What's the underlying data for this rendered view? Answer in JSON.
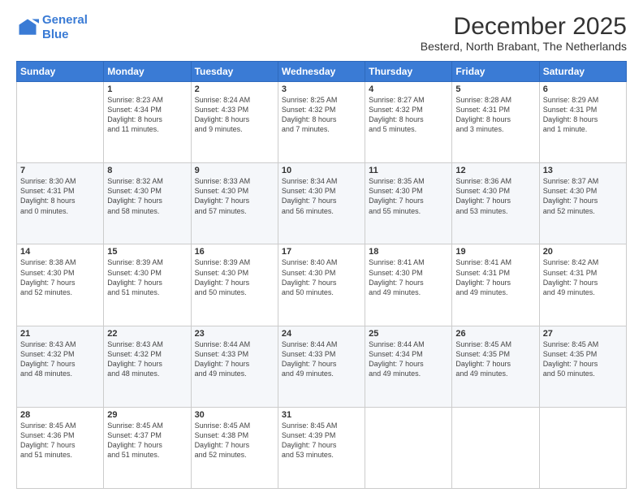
{
  "logo": {
    "line1": "General",
    "line2": "Blue"
  },
  "title": "December 2025",
  "subtitle": "Besterd, North Brabant, The Netherlands",
  "days_of_week": [
    "Sunday",
    "Monday",
    "Tuesday",
    "Wednesday",
    "Thursday",
    "Friday",
    "Saturday"
  ],
  "weeks": [
    [
      {
        "num": "",
        "info": ""
      },
      {
        "num": "1",
        "info": "Sunrise: 8:23 AM\nSunset: 4:34 PM\nDaylight: 8 hours\nand 11 minutes."
      },
      {
        "num": "2",
        "info": "Sunrise: 8:24 AM\nSunset: 4:33 PM\nDaylight: 8 hours\nand 9 minutes."
      },
      {
        "num": "3",
        "info": "Sunrise: 8:25 AM\nSunset: 4:32 PM\nDaylight: 8 hours\nand 7 minutes."
      },
      {
        "num": "4",
        "info": "Sunrise: 8:27 AM\nSunset: 4:32 PM\nDaylight: 8 hours\nand 5 minutes."
      },
      {
        "num": "5",
        "info": "Sunrise: 8:28 AM\nSunset: 4:31 PM\nDaylight: 8 hours\nand 3 minutes."
      },
      {
        "num": "6",
        "info": "Sunrise: 8:29 AM\nSunset: 4:31 PM\nDaylight: 8 hours\nand 1 minute."
      }
    ],
    [
      {
        "num": "7",
        "info": "Sunrise: 8:30 AM\nSunset: 4:31 PM\nDaylight: 8 hours\nand 0 minutes."
      },
      {
        "num": "8",
        "info": "Sunrise: 8:32 AM\nSunset: 4:30 PM\nDaylight: 7 hours\nand 58 minutes."
      },
      {
        "num": "9",
        "info": "Sunrise: 8:33 AM\nSunset: 4:30 PM\nDaylight: 7 hours\nand 57 minutes."
      },
      {
        "num": "10",
        "info": "Sunrise: 8:34 AM\nSunset: 4:30 PM\nDaylight: 7 hours\nand 56 minutes."
      },
      {
        "num": "11",
        "info": "Sunrise: 8:35 AM\nSunset: 4:30 PM\nDaylight: 7 hours\nand 55 minutes."
      },
      {
        "num": "12",
        "info": "Sunrise: 8:36 AM\nSunset: 4:30 PM\nDaylight: 7 hours\nand 53 minutes."
      },
      {
        "num": "13",
        "info": "Sunrise: 8:37 AM\nSunset: 4:30 PM\nDaylight: 7 hours\nand 52 minutes."
      }
    ],
    [
      {
        "num": "14",
        "info": "Sunrise: 8:38 AM\nSunset: 4:30 PM\nDaylight: 7 hours\nand 52 minutes."
      },
      {
        "num": "15",
        "info": "Sunrise: 8:39 AM\nSunset: 4:30 PM\nDaylight: 7 hours\nand 51 minutes."
      },
      {
        "num": "16",
        "info": "Sunrise: 8:39 AM\nSunset: 4:30 PM\nDaylight: 7 hours\nand 50 minutes."
      },
      {
        "num": "17",
        "info": "Sunrise: 8:40 AM\nSunset: 4:30 PM\nDaylight: 7 hours\nand 50 minutes."
      },
      {
        "num": "18",
        "info": "Sunrise: 8:41 AM\nSunset: 4:30 PM\nDaylight: 7 hours\nand 49 minutes."
      },
      {
        "num": "19",
        "info": "Sunrise: 8:41 AM\nSunset: 4:31 PM\nDaylight: 7 hours\nand 49 minutes."
      },
      {
        "num": "20",
        "info": "Sunrise: 8:42 AM\nSunset: 4:31 PM\nDaylight: 7 hours\nand 49 minutes."
      }
    ],
    [
      {
        "num": "21",
        "info": "Sunrise: 8:43 AM\nSunset: 4:32 PM\nDaylight: 7 hours\nand 48 minutes."
      },
      {
        "num": "22",
        "info": "Sunrise: 8:43 AM\nSunset: 4:32 PM\nDaylight: 7 hours\nand 48 minutes."
      },
      {
        "num": "23",
        "info": "Sunrise: 8:44 AM\nSunset: 4:33 PM\nDaylight: 7 hours\nand 49 minutes."
      },
      {
        "num": "24",
        "info": "Sunrise: 8:44 AM\nSunset: 4:33 PM\nDaylight: 7 hours\nand 49 minutes."
      },
      {
        "num": "25",
        "info": "Sunrise: 8:44 AM\nSunset: 4:34 PM\nDaylight: 7 hours\nand 49 minutes."
      },
      {
        "num": "26",
        "info": "Sunrise: 8:45 AM\nSunset: 4:35 PM\nDaylight: 7 hours\nand 49 minutes."
      },
      {
        "num": "27",
        "info": "Sunrise: 8:45 AM\nSunset: 4:35 PM\nDaylight: 7 hours\nand 50 minutes."
      }
    ],
    [
      {
        "num": "28",
        "info": "Sunrise: 8:45 AM\nSunset: 4:36 PM\nDaylight: 7 hours\nand 51 minutes."
      },
      {
        "num": "29",
        "info": "Sunrise: 8:45 AM\nSunset: 4:37 PM\nDaylight: 7 hours\nand 51 minutes."
      },
      {
        "num": "30",
        "info": "Sunrise: 8:45 AM\nSunset: 4:38 PM\nDaylight: 7 hours\nand 52 minutes."
      },
      {
        "num": "31",
        "info": "Sunrise: 8:45 AM\nSunset: 4:39 PM\nDaylight: 7 hours\nand 53 minutes."
      },
      {
        "num": "",
        "info": ""
      },
      {
        "num": "",
        "info": ""
      },
      {
        "num": "",
        "info": ""
      }
    ]
  ]
}
